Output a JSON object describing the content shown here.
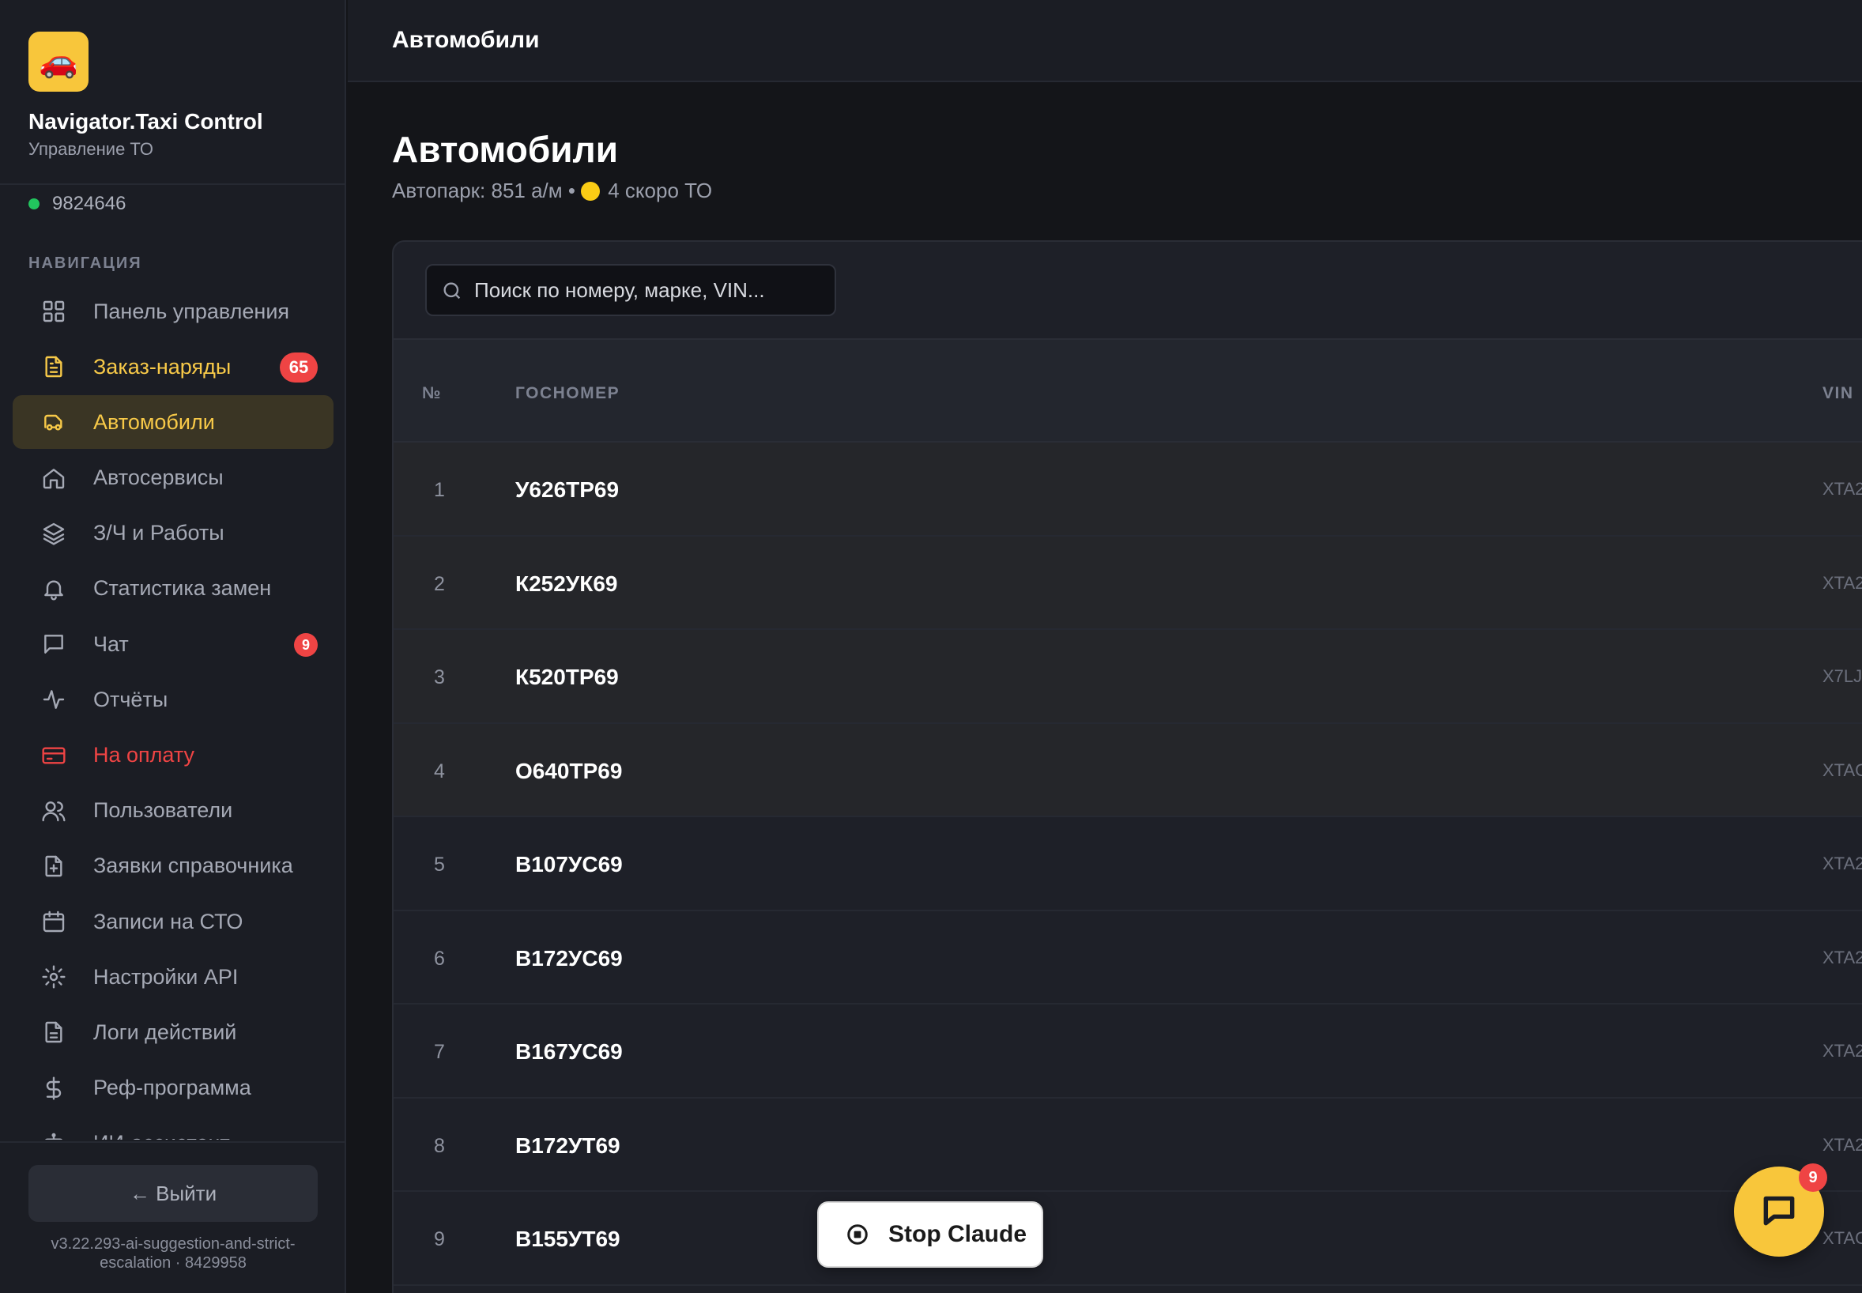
{
  "app": {
    "logo_emoji": "🚗",
    "title": "Navigator.Taxi Control",
    "subtitle": "Управление ТО",
    "user_id": "9824646",
    "online_color": "#22c55e",
    "accent_color": "#f8c63b"
  },
  "sidebar": {
    "heading": "НАВИГАЦИЯ",
    "items": [
      {
        "label": "Панель управления",
        "icon": "dashboard-grid-icon",
        "state": "normal"
      },
      {
        "label": "Заказ-наряды",
        "icon": "document-icon",
        "state": "warn",
        "badge": "65"
      },
      {
        "label": "Автомобили",
        "icon": "car-icon",
        "state": "active"
      },
      {
        "label": "Автосервисы",
        "icon": "home-icon",
        "state": "normal"
      },
      {
        "label": "З/Ч и Работы",
        "icon": "layers-icon",
        "state": "normal"
      },
      {
        "label": "Статистика замен",
        "icon": "bell-icon",
        "state": "normal"
      },
      {
        "label": "Чат",
        "icon": "chat-icon",
        "state": "normal",
        "badge": "9"
      },
      {
        "label": "Отчёты",
        "icon": "activity-icon",
        "state": "normal"
      },
      {
        "label": "На оплату",
        "icon": "credit-card-icon",
        "state": "danger"
      },
      {
        "label": "Пользователи",
        "icon": "users-icon",
        "state": "normal"
      },
      {
        "label": "Заявки справочника",
        "icon": "file-plus-icon",
        "state": "normal"
      },
      {
        "label": "Записи на СТО",
        "icon": "calendar-icon",
        "state": "normal"
      },
      {
        "label": "Настройки API",
        "icon": "gear-icon",
        "state": "normal"
      },
      {
        "label": "Логи действий",
        "icon": "file-text-icon",
        "state": "normal"
      },
      {
        "label": "Реф-программа",
        "icon": "dollar-icon",
        "state": "normal"
      },
      {
        "label": "ИИ-ассистент",
        "icon": "bot-icon",
        "state": "normal"
      }
    ],
    "logout_label": "← Выйти",
    "version": "v3.22.293-ai-suggestion-and-strict-escalation · 8429958"
  },
  "topbar": {
    "title": "Автомобили"
  },
  "page": {
    "title": "Автомобили",
    "subtitle_before": "Автопарк: 851 а/м • ",
    "subtitle_after": "4 скоро ТО",
    "soon_dot_color": "#facc15"
  },
  "search": {
    "placeholder": "Поиск по номеру, марке, VIN..."
  },
  "table": {
    "columns": {
      "num": "№",
      "plate": "ГОСНОМЕР",
      "vin": "VIN"
    },
    "rows": [
      {
        "num": "1",
        "plate": "У626ТР69",
        "vin": "XTA2",
        "highlight": true
      },
      {
        "num": "2",
        "plate": "К252УК69",
        "vin": "XTA2",
        "highlight": true
      },
      {
        "num": "3",
        "plate": "К520ТР69",
        "vin": "X7LJ",
        "highlight": true
      },
      {
        "num": "4",
        "plate": "О640ТР69",
        "vin": "XTAG",
        "highlight": true
      },
      {
        "num": "5",
        "plate": "В107УС69",
        "vin": "XTA2",
        "highlight": false
      },
      {
        "num": "6",
        "plate": "В172УС69",
        "vin": "XTA2",
        "highlight": false
      },
      {
        "num": "7",
        "plate": "В167УС69",
        "vin": "XTA2",
        "highlight": false
      },
      {
        "num": "8",
        "plate": "В172УТ69",
        "vin": "XTA2",
        "highlight": false
      },
      {
        "num": "9",
        "plate": "В155УТ69",
        "vin": "XTAG",
        "highlight": false
      }
    ]
  },
  "overlay": {
    "stop_label": "Stop Claude",
    "chat_badge": "9"
  }
}
